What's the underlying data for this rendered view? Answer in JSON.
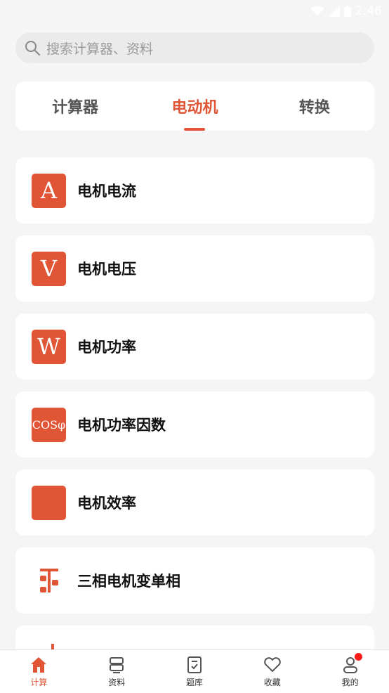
{
  "status": {
    "time": "2:46"
  },
  "search": {
    "placeholder": "搜索计算器、资料"
  },
  "tabs": [
    {
      "label": "计算器",
      "active": false
    },
    {
      "label": "电动机",
      "active": true
    },
    {
      "label": "转换",
      "active": false
    }
  ],
  "items": [
    {
      "label": "电机电流",
      "icon_text": "A",
      "icon": "ampere-icon"
    },
    {
      "label": "电机电压",
      "icon_text": "V",
      "icon": "volt-icon"
    },
    {
      "label": "电机功率",
      "icon_text": "W",
      "icon": "watt-icon"
    },
    {
      "label": "电机功率因数",
      "icon_text": "COSφ",
      "icon": "power-factor-icon"
    },
    {
      "label": "电机效率",
      "icon_text": "",
      "icon": "efficiency-icon"
    },
    {
      "label": "三相电机变单相",
      "icon_text": "",
      "icon": "phase-converter-icon"
    }
  ],
  "nav": [
    {
      "label": "计算",
      "icon": "home-icon",
      "active": true
    },
    {
      "label": "资料",
      "icon": "document-icon",
      "active": false
    },
    {
      "label": "题库",
      "icon": "quiz-icon",
      "active": false
    },
    {
      "label": "收藏",
      "icon": "heart-icon",
      "active": false
    },
    {
      "label": "我的",
      "icon": "profile-icon",
      "active": false
    }
  ],
  "colors": {
    "accent": "#e05535",
    "background": "#f5f5f5",
    "notification_dot": "#ff1a1a"
  }
}
